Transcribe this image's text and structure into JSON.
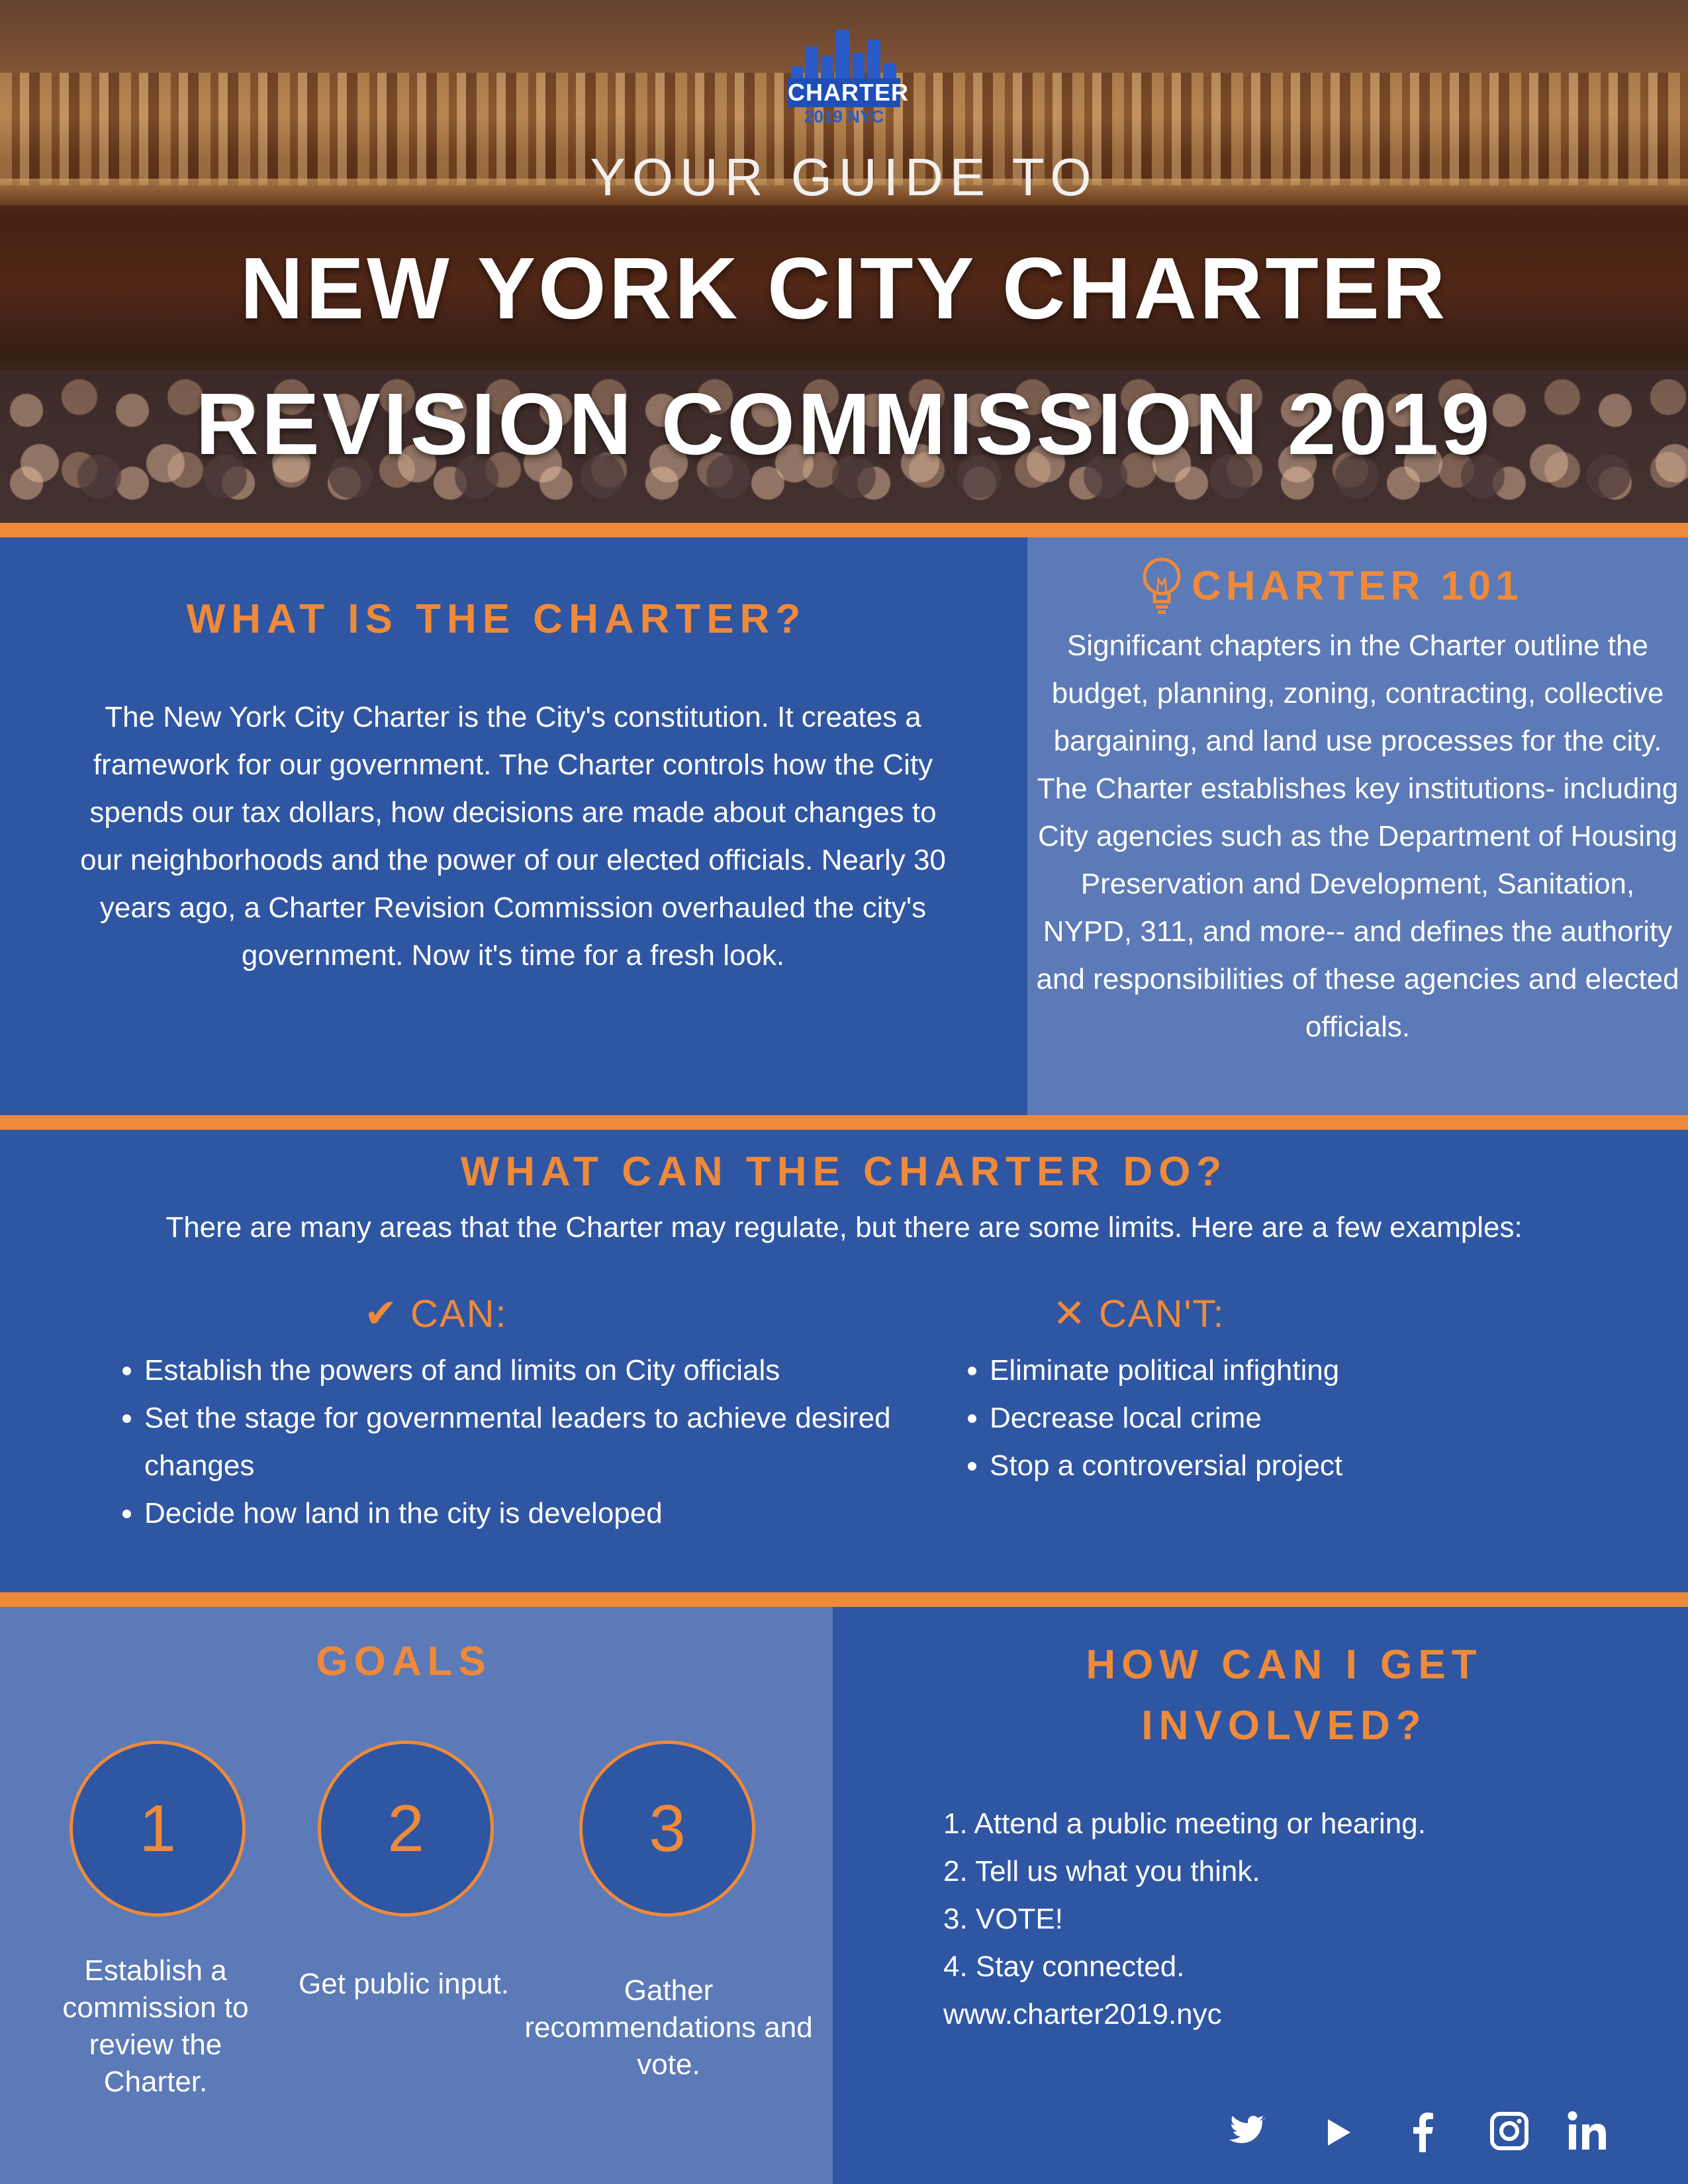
{
  "header": {
    "logo_text": "CHARTER",
    "logo_sub": "2019 NYC",
    "guide": "YOUR GUIDE TO",
    "title_line1": "NEW YORK CITY CHARTER",
    "title_line2": "REVISION COMMISSION 2019"
  },
  "what": {
    "heading": "WHAT IS THE CHARTER?",
    "body": "The New York City Charter is the City's constitution. It creates a framework for our government. The Charter controls how the City spends our tax dollars, how decisions are made about changes to our neighborhoods and the power of our elected officials. Nearly 30 years ago, a Charter Revision Commission overhauled the city's government. Now it's time for a fresh look."
  },
  "charter101": {
    "heading": "CHARTER 101",
    "body": "Significant chapters in the Charter outline the budget, planning, zoning, contracting, collective bargaining, and land use processes for the city. The Charter establishes key institutions- including City agencies such as the Department of Housing Preservation and Development, Sanitation, NYPD, 311, and more-- and defines the authority and responsibilities of these agencies and elected officials."
  },
  "cando": {
    "heading": "WHAT CAN THE CHARTER DO?",
    "intro": "There are many areas that the Charter may regulate, but there are some limits. Here are a few examples:",
    "can_label": "CAN:",
    "cant_label": "CAN'T:",
    "can_items": [
      "Establish the powers of and limits on City officials",
      "Set the stage for governmental leaders to achieve desired changes",
      "Decide how land in the city is developed"
    ],
    "cant_items": [
      "Eliminate political infighting",
      "Decrease local crime",
      "Stop a controversial project"
    ]
  },
  "goals": {
    "heading": "GOALS",
    "items": [
      {
        "num": "1",
        "text": "Establish a commission to review the Charter."
      },
      {
        "num": "2",
        "text": "Get public input."
      },
      {
        "num": "3",
        "text": "Gather recommendations and vote."
      }
    ]
  },
  "involved": {
    "heading_line1": "HOW CAN I GET",
    "heading_line2": "INVOLVED?",
    "items": [
      "1. Attend a public meeting or hearing.",
      "2. Tell us what you think.",
      "3. VOTE!",
      "4. Stay connected.",
      "www.charter2019.nyc"
    ]
  },
  "colors": {
    "accent": "#ef8a3a",
    "dark_blue": "#2f56a3",
    "light_blue": "#5c7ab7"
  },
  "icons": [
    "lightbulb-icon",
    "check-icon",
    "x-icon",
    "twitter-icon",
    "youtube-icon",
    "facebook-icon",
    "instagram-icon",
    "linkedin-icon"
  ]
}
